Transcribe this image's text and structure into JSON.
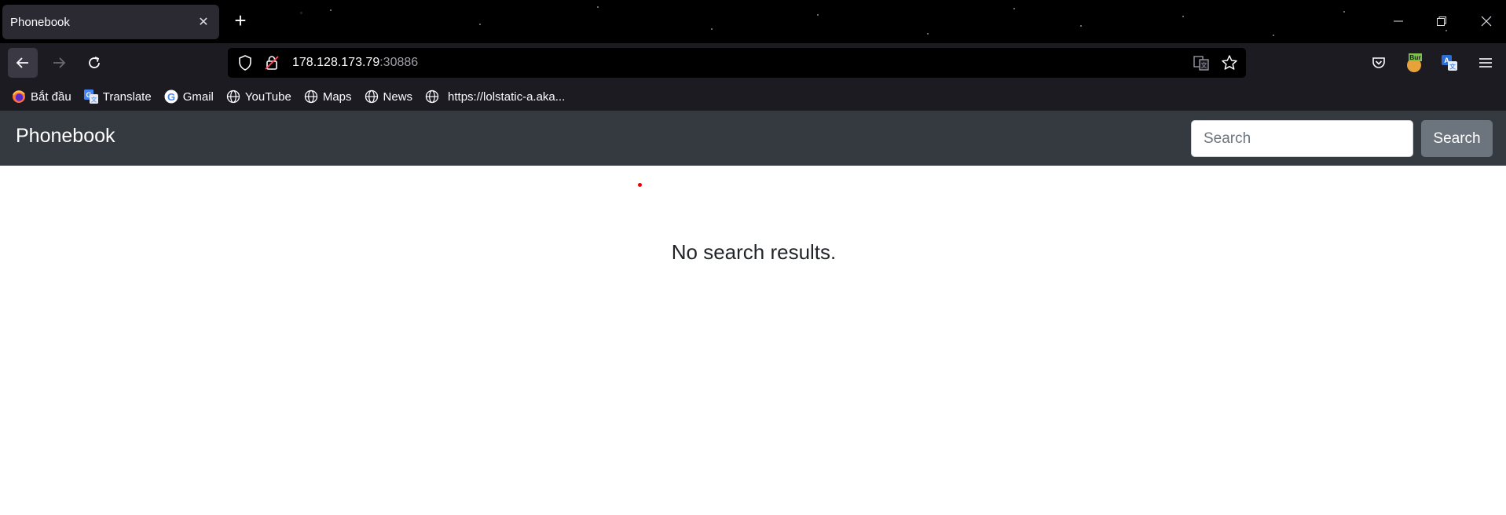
{
  "browser": {
    "tab_title": "Phonebook",
    "url_host": "178.128.173.79",
    "url_port": ":30886",
    "extension_badge": "Bur",
    "bookmarks": [
      {
        "label": "Bắt đầu",
        "icon": "firefox-icon"
      },
      {
        "label": "Translate",
        "icon": "translate-icon"
      },
      {
        "label": "Gmail",
        "icon": "google-icon"
      },
      {
        "label": "YouTube",
        "icon": "globe-icon"
      },
      {
        "label": "Maps",
        "icon": "globe-icon"
      },
      {
        "label": "News",
        "icon": "globe-icon"
      },
      {
        "label": "https://lolstatic-a.aka...",
        "icon": "globe-icon"
      }
    ]
  },
  "page": {
    "brand": "Phonebook",
    "search_placeholder": "Search",
    "search_button": "Search",
    "message": "No search results."
  },
  "colors": {
    "header_bg": "#343a40",
    "search_button_bg": "#6c757d",
    "browser_chrome": "#1c1b22"
  }
}
